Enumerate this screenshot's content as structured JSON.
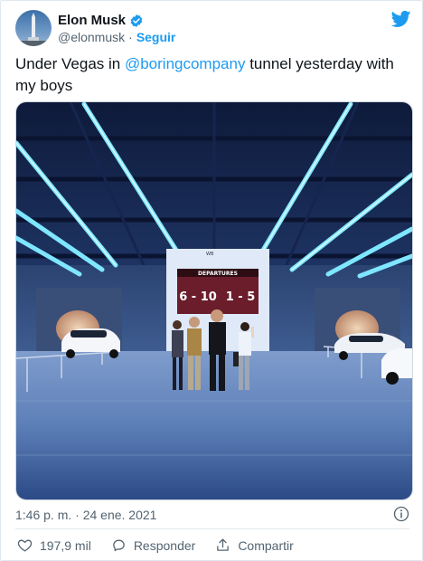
{
  "author": {
    "display_name": "Elon Musk",
    "handle": "@elonmusk",
    "separator": "·",
    "follow_label": "Seguir"
  },
  "tweet": {
    "text_before": "Under Vegas in ",
    "mention": "@boringcompany",
    "text_after": " tunnel yesterday with my boys"
  },
  "photo": {
    "sign_small": "WB",
    "board_title": "DEPARTURES",
    "board_left": "6 - 10",
    "board_right": "1 - 5"
  },
  "meta": {
    "timestamp": "1:46 p. m. · 24 ene. 2021"
  },
  "actions": {
    "likes": "197,9 mil",
    "reply_label": "Responder",
    "share_label": "Compartir"
  },
  "colors": {
    "accent": "#1d9bf0",
    "secondary_text": "#536471",
    "border": "#e1e8ed"
  },
  "icons": [
    "avatar",
    "verified-badge-icon",
    "twitter-bird-icon",
    "info-icon",
    "heart-icon",
    "reply-bubble-icon",
    "share-icon"
  ]
}
